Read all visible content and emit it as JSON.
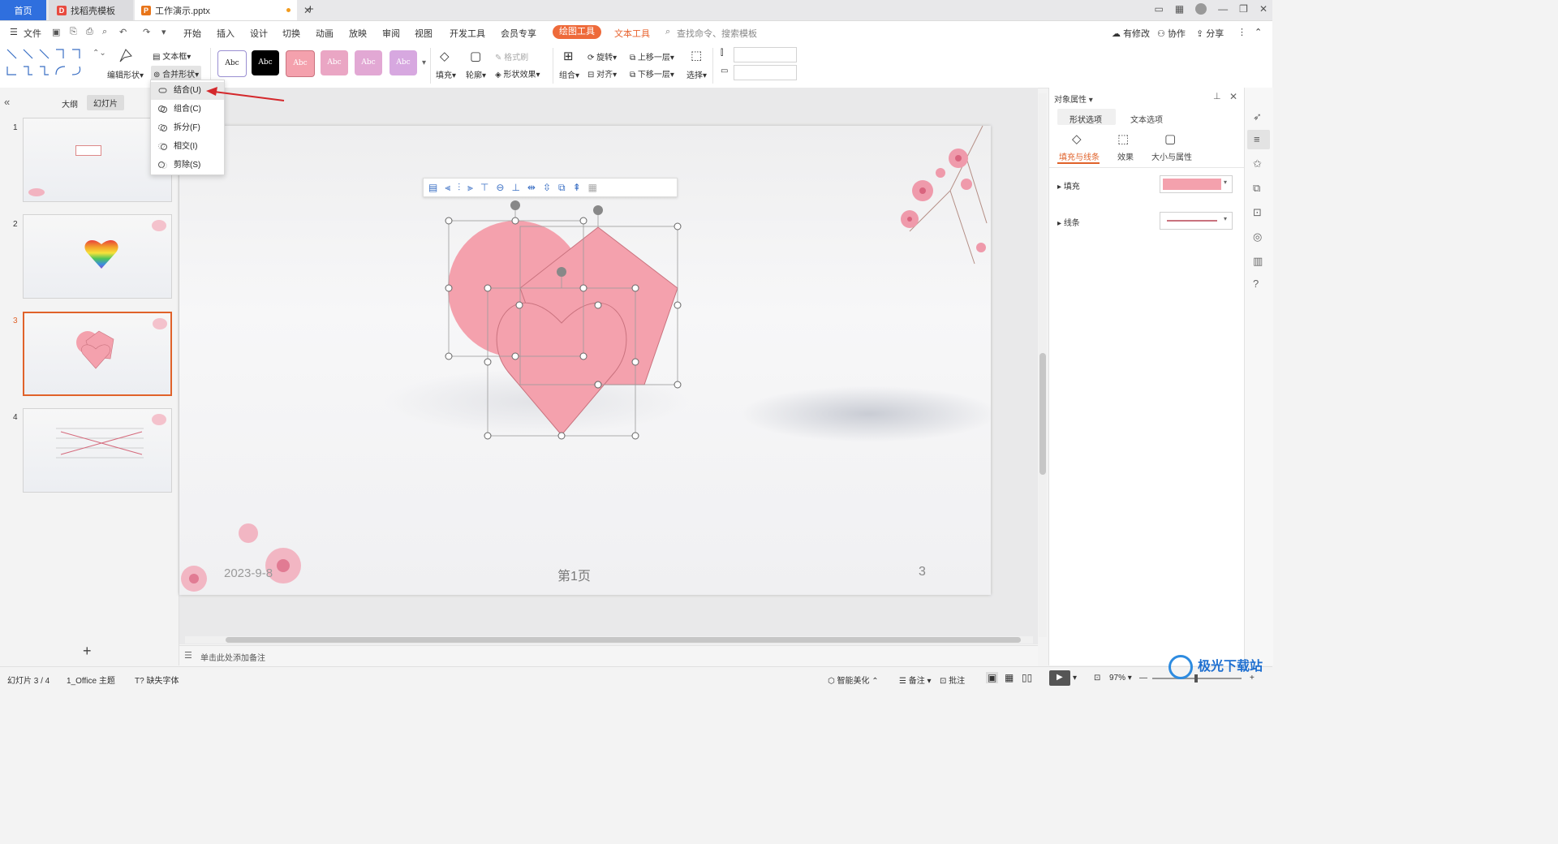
{
  "titlebar": {
    "home_tab": "首页",
    "template_tab": "找稻壳模板",
    "file_tab": "工作演示.pptx",
    "new_tab": "+"
  },
  "menu": {
    "file": "文件",
    "items": [
      "开始",
      "插入",
      "设计",
      "切换",
      "动画",
      "放映",
      "审阅",
      "视图",
      "开发工具",
      "会员专享"
    ],
    "drawing_tools": "绘图工具",
    "text_tools": "文本工具",
    "search_placeholder": "查找命令、搜索模板",
    "changes": "有修改",
    "collaborate": "协作",
    "share": "分享"
  },
  "ribbon": {
    "edit_shape": "编辑形状",
    "text_box": "文本框",
    "merge_shape": "合并形状",
    "style_label": "Abc",
    "fill": "填充",
    "outline": "轮廓",
    "format_painter": "格式刷",
    "shape_effect": "形状效果",
    "group": "组合",
    "rotate": "旋转",
    "align": "对齐",
    "bring_forward": "上移一层",
    "send_backward": "下移一层",
    "select": "选择"
  },
  "merge_menu": {
    "items": [
      "结合(U)",
      "组合(C)",
      "拆分(F)",
      "相交(I)",
      "剪除(S)"
    ]
  },
  "left_panel": {
    "tab_outline": "大纲",
    "tab_slides": "幻灯片",
    "slide_numbers": [
      "1",
      "2",
      "3",
      "4"
    ],
    "add_slide": "+"
  },
  "slide": {
    "date": "2023-9-8",
    "page_label": "第1页",
    "page_number": "3",
    "notes_placeholder": "单击此处添加备注"
  },
  "right_panel": {
    "title": "对象属性",
    "tab_shape": "形状选项",
    "tab_text": "文本选项",
    "sub_fill_line": "填充与线条",
    "sub_effect": "效果",
    "sub_size": "大小与属性",
    "fill_label": "填充",
    "line_label": "线条",
    "fill_color": "#f4a1ad",
    "line_color": "#c9727e"
  },
  "status": {
    "slide_count": "幻灯片 3 / 4",
    "theme": "1_Office 主题",
    "missing_font": "缺失字体",
    "smart_beautify": "智能美化",
    "notes": "备注",
    "comments": "批注",
    "zoom": "97%"
  },
  "watermark": "极光下载站"
}
